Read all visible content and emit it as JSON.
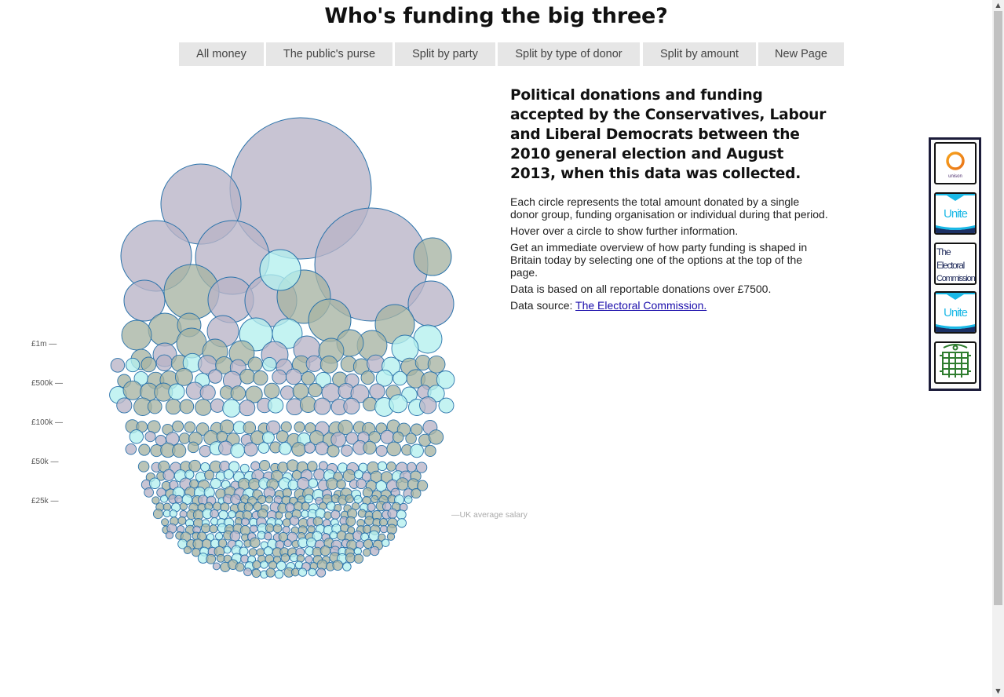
{
  "page": {
    "title": "Who's funding the big three?"
  },
  "nav": {
    "items": [
      {
        "label": "All money"
      },
      {
        "label": "The public's purse"
      },
      {
        "label": "Split by party"
      },
      {
        "label": "Split by type of donor"
      },
      {
        "label": "Split by amount"
      },
      {
        "label": "New Page"
      }
    ]
  },
  "info": {
    "heading": "Political donations and funding accepted by the Conservatives, Labour and Liberal Democrats between the 2010 general election and August 2013, when this data was collected.",
    "p1": "Each circle represents the total amount donated by a single donor group, funding organisation or individual during that period.",
    "p2": "Hover over a circle to show further information.",
    "p3": "Get an immediate overview of how party funding is shaped in Britain today by selecting one of the options at the top of the page.",
    "p4": "Data is based on all reportable donations over £7500.",
    "source_prefix": "Data source: ",
    "source_link": "The Electoral Commission."
  },
  "chart_data": {
    "type": "bubble",
    "scale_labels": [
      "£1m —",
      "£500k —",
      "£100k —",
      "£50k —",
      "£25k —"
    ],
    "reference_label": "—UK average salary",
    "colors": {
      "purple": "#b9b3c6",
      "olive": "#a7b3a3",
      "cyan": "#b4efee",
      "stroke": "#2a73ab"
    }
  },
  "logo_panel": {
    "logos": [
      {
        "name": "unison-logo",
        "text": "unison"
      },
      {
        "name": "unite-logo",
        "text": "Unite"
      },
      {
        "name": "electoral-commission-logo",
        "lines": [
          "The",
          "Electoral",
          "Commission"
        ]
      },
      {
        "name": "unite-logo-2",
        "text": "Unite"
      },
      {
        "name": "parliament-portcullis-logo"
      }
    ]
  },
  "colors": {
    "nav_bg": "#e6e6e6",
    "panel_border": "#1c1c3a"
  }
}
